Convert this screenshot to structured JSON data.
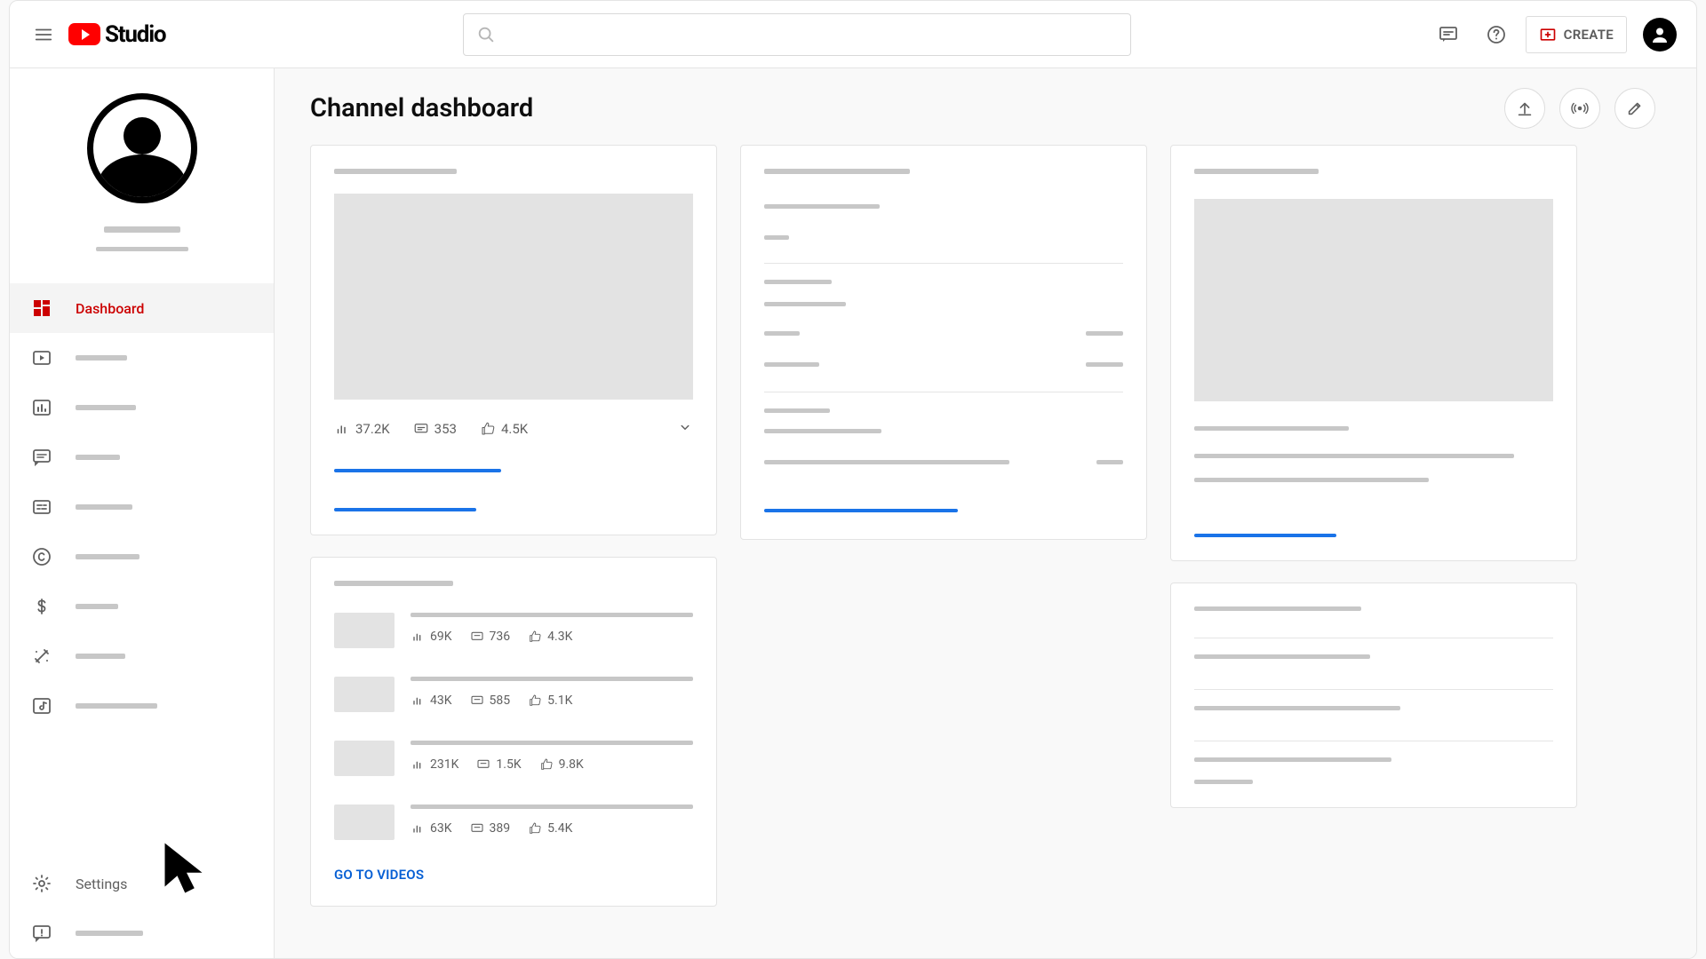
{
  "header": {
    "logo_text": "Studio",
    "search_placeholder": "",
    "create_label": "CREATE"
  },
  "sidebar": {
    "items": [
      {
        "id": "dashboard",
        "label": "Dashboard",
        "icon": "dashboard",
        "active": true
      },
      {
        "id": "content",
        "label": "",
        "icon": "play-box",
        "active": false
      },
      {
        "id": "analytics",
        "label": "",
        "icon": "bar-chart",
        "active": false
      },
      {
        "id": "comments",
        "label": "",
        "icon": "comment",
        "active": false
      },
      {
        "id": "subtitles",
        "label": "",
        "icon": "subtitles",
        "active": false
      },
      {
        "id": "copyright",
        "label": "",
        "icon": "copyright",
        "active": false
      },
      {
        "id": "monetization",
        "label": "",
        "icon": "dollar",
        "active": false
      },
      {
        "id": "customization",
        "label": "",
        "icon": "wand",
        "active": false
      },
      {
        "id": "audio",
        "label": "",
        "icon": "audio-lib",
        "active": false
      }
    ],
    "bottom": [
      {
        "id": "settings",
        "label": "Settings",
        "icon": "gear"
      },
      {
        "id": "feedback",
        "label": "",
        "icon": "feedback"
      }
    ]
  },
  "main": {
    "title": "Channel dashboard",
    "latest_video": {
      "views": "37.2K",
      "comments": "353",
      "likes": "4.5K"
    },
    "videos": [
      {
        "views": "69K",
        "comments": "736",
        "likes": "4.3K"
      },
      {
        "views": "43K",
        "comments": "585",
        "likes": "5.1K"
      },
      {
        "views": "231K",
        "comments": "1.5K",
        "likes": "9.8K"
      },
      {
        "views": "63K",
        "comments": "389",
        "likes": "5.4K"
      }
    ],
    "go_to_videos": "GO TO VIDEOS"
  }
}
